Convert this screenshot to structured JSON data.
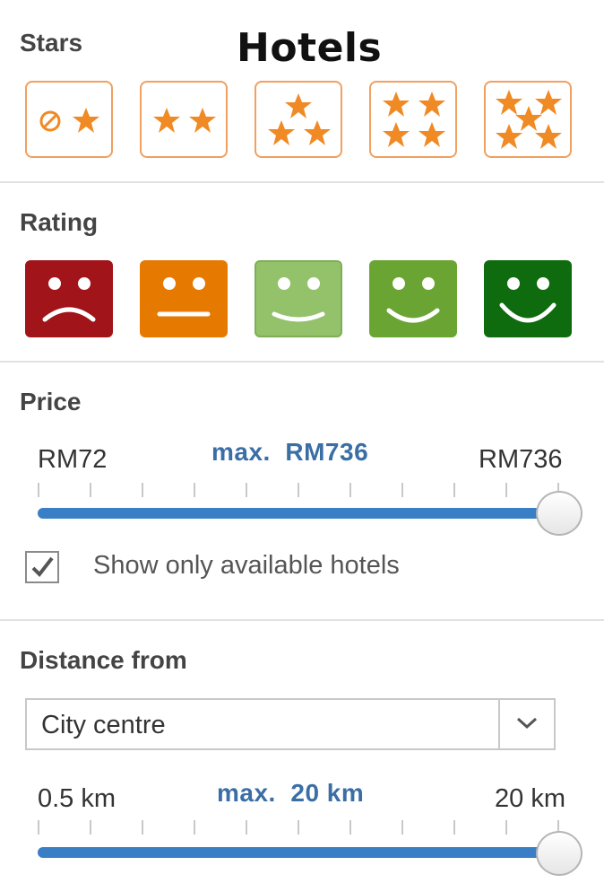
{
  "title": "Hotels",
  "stars": {
    "heading": "Stars",
    "options": [
      {
        "name": "no-or-one-star",
        "count": 1
      },
      {
        "name": "two-star",
        "count": 2
      },
      {
        "name": "three-star",
        "count": 3
      },
      {
        "name": "four-star",
        "count": 4
      },
      {
        "name": "five-star",
        "count": 5
      }
    ],
    "icon": "star-icon",
    "color": "#f08a24"
  },
  "rating": {
    "heading": "Rating",
    "options": [
      {
        "name": "very-bad-face-icon",
        "color": "#a0141a"
      },
      {
        "name": "neutral-face-icon",
        "color": "#e67a00"
      },
      {
        "name": "okay-face-icon",
        "color": "#93c26a"
      },
      {
        "name": "good-face-icon",
        "color": "#6aa533"
      },
      {
        "name": "excellent-face-icon",
        "color": "#0e6b0e"
      }
    ]
  },
  "price": {
    "heading": "Price",
    "min_label": "RM72",
    "max_text": "max.  RM736",
    "max_label": "RM736",
    "min_value": 72,
    "max_value": 736,
    "selected_value": 736
  },
  "availability": {
    "checked": true,
    "label": "Show only available hotels"
  },
  "distance": {
    "heading": "Distance from",
    "select_value": "City centre",
    "min_label": "0.5 km",
    "max_text": "max.  20 km",
    "max_label": "20 km",
    "min_value": 0.5,
    "max_value": 20,
    "selected_value": 20
  },
  "colors": {
    "accent": "#3a7ec6",
    "max_text": "#3a6ea5",
    "star_border": "#f0a060"
  }
}
